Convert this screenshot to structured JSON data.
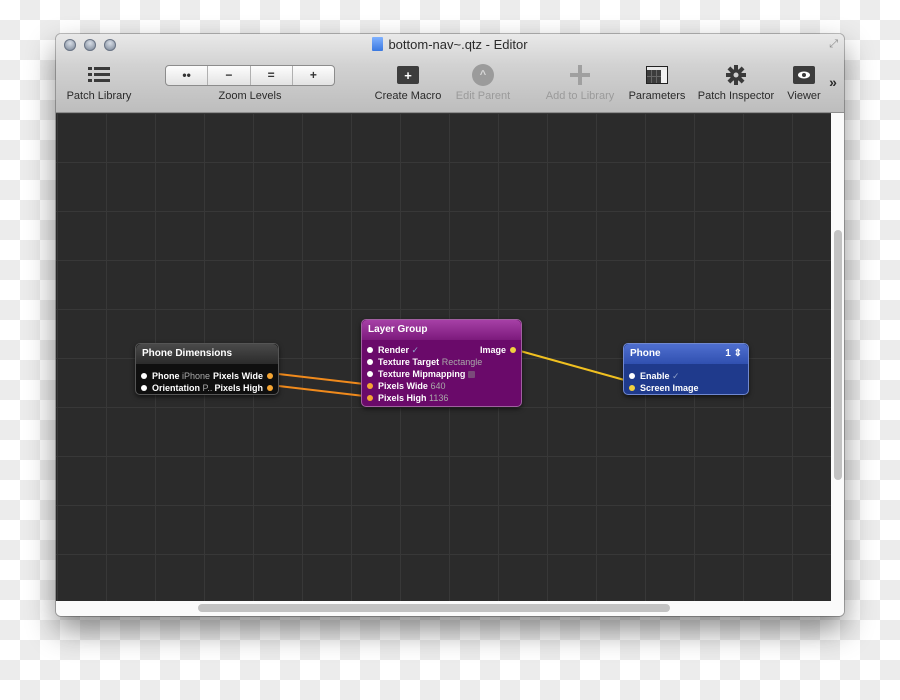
{
  "window": {
    "title": "bottom-nav~.qtz - Editor",
    "doc_icon": "qtz-document-icon",
    "fullscreen_icon": "fullscreen-arrows-icon"
  },
  "toolbar": {
    "patch_library": {
      "label": "Patch Library",
      "icon": "list-icon"
    },
    "zoom_levels": {
      "label": "Zoom Levels",
      "segments": [
        "••",
        "−",
        "=",
        "+"
      ]
    },
    "create_macro": {
      "label": "Create Macro",
      "icon": "+"
    },
    "edit_parent": {
      "label": "Edit Parent",
      "icon": "^",
      "enabled": false
    },
    "add_to_library": {
      "label": "Add to Library",
      "icon": "+",
      "enabled": false
    },
    "parameters": {
      "label": "Parameters",
      "icon": "table-icon"
    },
    "patch_inspector": {
      "label": "Patch Inspector",
      "icon": "gear-icon"
    },
    "viewer": {
      "label": "Viewer",
      "icon": "eye-icon"
    },
    "overflow": "»"
  },
  "nodes": {
    "phone_dimensions": {
      "title": "Phone Dimensions",
      "rows": [
        {
          "input": "Phone",
          "value": "iPhone",
          "output": "Pixels Wide"
        },
        {
          "input": "Orientation",
          "value": "P..",
          "output": "Pixels High"
        }
      ]
    },
    "layer_group": {
      "title": "Layer Group",
      "rows": [
        {
          "input": "Render",
          "value": "✓",
          "output": "Image"
        },
        {
          "input": "Texture Target",
          "value": "Rectangle"
        },
        {
          "input": "Texture Mipmapping",
          "value": ""
        },
        {
          "input": "Pixels Wide",
          "value": "640"
        },
        {
          "input": "Pixels High",
          "value": "1136"
        }
      ]
    },
    "phone": {
      "title": "Phone",
      "selector": "1 ⇕",
      "rows": [
        {
          "input": "Enable",
          "value": "✓"
        },
        {
          "input": "Screen Image",
          "value": ""
        }
      ]
    }
  },
  "connections": [
    {
      "from": "Phone Dimensions.Pixels Wide",
      "to": "Layer Group.Pixels Wide",
      "color": "#f08a1c"
    },
    {
      "from": "Phone Dimensions.Pixels High",
      "to": "Layer Group.Pixels High",
      "color": "#f08a1c"
    },
    {
      "from": "Layer Group.Image",
      "to": "Phone.Screen Image",
      "color": "#f0c020"
    }
  ]
}
